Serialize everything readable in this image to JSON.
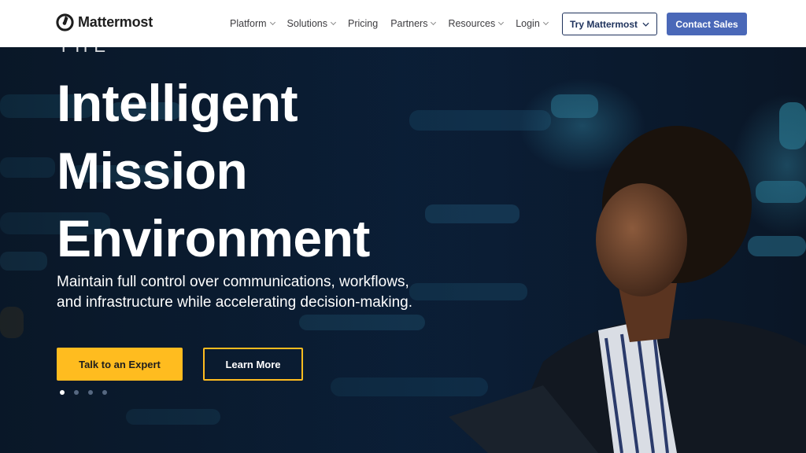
{
  "brand": {
    "name": "Mattermost",
    "logo_icon": "mattermost-logo-icon"
  },
  "nav": {
    "items": [
      {
        "label": "Platform",
        "has_dropdown": true
      },
      {
        "label": "Solutions",
        "has_dropdown": true
      },
      {
        "label": "Pricing",
        "has_dropdown": false
      },
      {
        "label": "Partners",
        "has_dropdown": true
      },
      {
        "label": "Resources",
        "has_dropdown": true
      },
      {
        "label": "Login",
        "has_dropdown": true
      }
    ]
  },
  "header_actions": {
    "try_label": "Try Mattermost",
    "contact_label": "Contact Sales"
  },
  "hero": {
    "eyebrow": "THE",
    "headline_lines": [
      "Intelligent",
      "Mission",
      "Environment"
    ],
    "subtext": "Maintain full control over communications, workflows, and infrastructure while accelerating decision-making.",
    "primary_cta": "Talk to an Expert",
    "secondary_cta": "Learn More",
    "slides_total": 4,
    "active_slide": 1
  },
  "colors": {
    "accent_yellow": "#ffbc1f",
    "brand_blue": "#4a68b8",
    "navy": "#1e325c",
    "hero_bg": "#0b1a2e"
  }
}
